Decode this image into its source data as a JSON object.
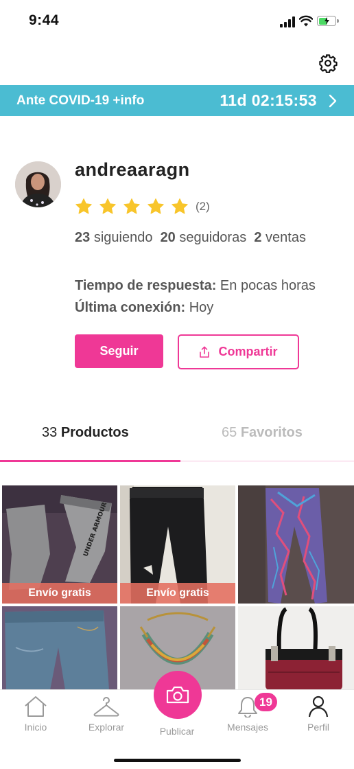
{
  "status_bar": {
    "time": "9:44"
  },
  "banner": {
    "left_text": "Ante COVID-19 +info",
    "countdown": "11d 02:15:53"
  },
  "profile": {
    "username": "andreaaragn",
    "rating_stars": 5,
    "rating_count": "(2)",
    "following_count": "23",
    "following_label": "siguiendo",
    "followers_count": "20",
    "followers_label": "seguidoras",
    "sales_count": "2",
    "sales_label": "ventas",
    "response_label": "Tiempo de respuesta:",
    "response_value": "En pocas horas",
    "last_seen_label": "Última conexión:",
    "last_seen_value": "Hoy"
  },
  "buttons": {
    "follow": "Seguir",
    "share": "Compartir"
  },
  "tabs": {
    "products_count": "33",
    "products_label": "Productos",
    "favorites_count": "65",
    "favorites_label": "Favoritos"
  },
  "grid": {
    "free_shipping_label": "Envío gratis",
    "items": [
      {
        "name": "grey-joggers",
        "free_shipping": true
      },
      {
        "name": "black-pants",
        "free_shipping": true
      },
      {
        "name": "patterned-leggings",
        "free_shipping": false
      },
      {
        "name": "jeans",
        "free_shipping": false
      },
      {
        "name": "beaded-necklace",
        "free_shipping": false
      },
      {
        "name": "red-handbag",
        "free_shipping": false
      }
    ]
  },
  "bottom_nav": {
    "items": [
      {
        "label": "Inicio"
      },
      {
        "label": "Explorar"
      },
      {
        "label": "Publicar"
      },
      {
        "label": "Mensajes"
      },
      {
        "label": "Perfil"
      }
    ],
    "messages_badge": "19"
  },
  "colors": {
    "accent": "#ef3896",
    "banner": "#4bbcd2",
    "star": "#f8c52b"
  }
}
